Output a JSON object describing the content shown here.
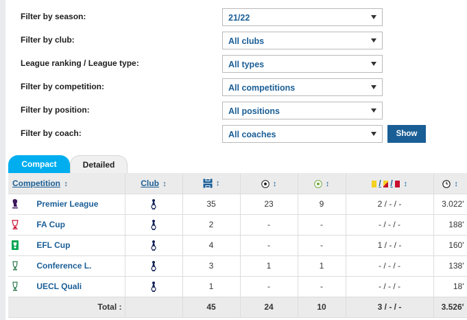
{
  "filters": [
    {
      "label": "Filter by season:",
      "value": "21/22"
    },
    {
      "label": "Filter by club:",
      "value": "All clubs"
    },
    {
      "label": "League ranking / League type:",
      "value": "All types"
    },
    {
      "label": "Filter by competition:",
      "value": "All competitions"
    },
    {
      "label": "Filter by position:",
      "value": "All positions"
    },
    {
      "label": "Filter by coach:",
      "value": "All coaches"
    }
  ],
  "show_button": "Show",
  "tabs": {
    "compact": "Compact",
    "detailed": "Detailed"
  },
  "table": {
    "headers": {
      "competition": "Competition",
      "club": "Club",
      "sort_glyph": "↕",
      "card_sep": "/"
    },
    "icons": {
      "appearances": "pitch-icon",
      "goals": "football-icon",
      "assists": "assist-ball-icon",
      "cards": "cards-icon",
      "minutes": "clock-icon",
      "club": "tottenham-crest-icon"
    },
    "colors": {
      "accent": "#1a5e96",
      "tab_active": "#00aeef",
      "yellow": "#f4d020",
      "red": "#c8102e"
    },
    "rows": [
      {
        "competition": "Premier League",
        "logo": "premier-league-logo",
        "apps": "35",
        "goals": "23",
        "assists": "9",
        "cards": "2 / - / -",
        "minutes": "3.022'"
      },
      {
        "competition": "FA Cup",
        "logo": "fa-cup-logo",
        "apps": "2",
        "goals": "-",
        "assists": "-",
        "cards": "- / - / -",
        "minutes": "188'"
      },
      {
        "competition": "EFL Cup",
        "logo": "efl-cup-logo",
        "apps": "4",
        "goals": "-",
        "assists": "-",
        "cards": "1 / - / -",
        "minutes": "160'"
      },
      {
        "competition": "Conference L.",
        "logo": "conference-league-logo",
        "apps": "3",
        "goals": "1",
        "assists": "1",
        "cards": "- / - / -",
        "minutes": "138'"
      },
      {
        "competition": "UECL Quali",
        "logo": "uecl-quali-logo",
        "apps": "1",
        "goals": "-",
        "assists": "-",
        "cards": "- / - / -",
        "minutes": "18'"
      }
    ],
    "total": {
      "label": "Total :",
      "apps": "45",
      "goals": "24",
      "assists": "10",
      "cards": "3 / - / -",
      "minutes": "3.526'"
    }
  }
}
